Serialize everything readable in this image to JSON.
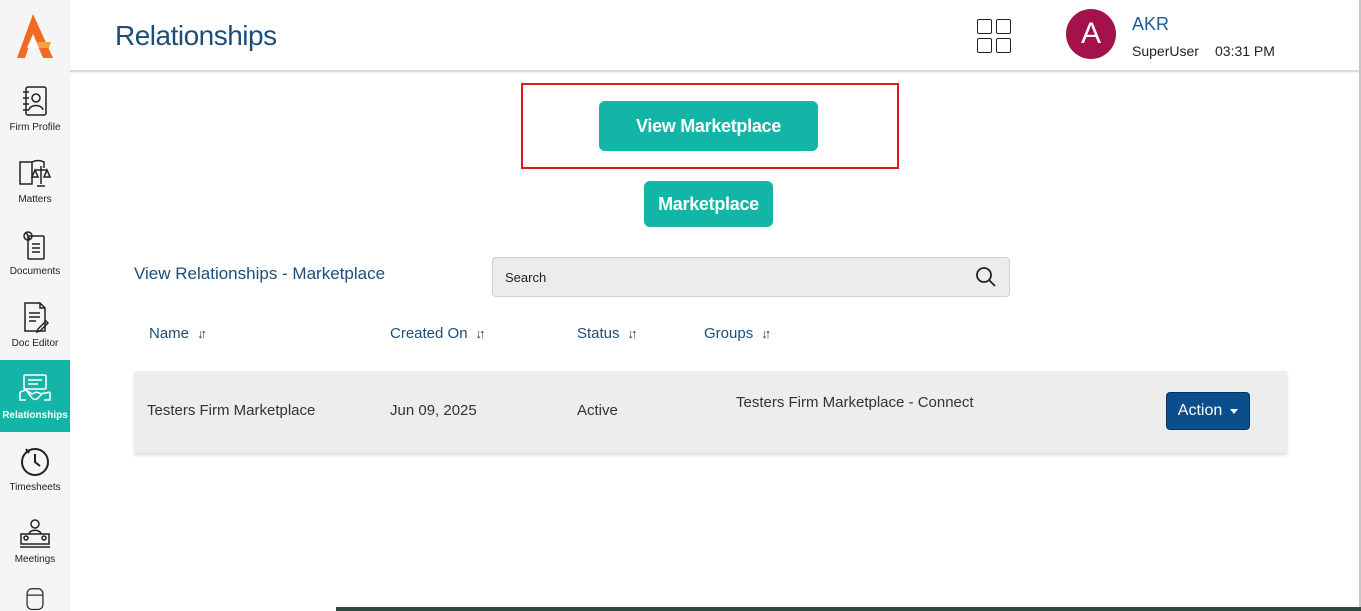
{
  "header": {
    "title": "Relationships",
    "user_initial": "A",
    "user_name": "AKR",
    "user_role": "SuperUser",
    "time": "03:31 PM"
  },
  "sidebar": {
    "items": [
      {
        "label": "Firm Profile",
        "icon": "firm-profile-icon"
      },
      {
        "label": "Matters",
        "icon": "scales-book-icon"
      },
      {
        "label": "Documents",
        "icon": "documents-icon"
      },
      {
        "label": "Doc Editor",
        "icon": "doc-editor-icon"
      },
      {
        "label": "Relationships",
        "icon": "handshake-icon",
        "active": true
      },
      {
        "label": "Timesheets",
        "icon": "timer-icon"
      },
      {
        "label": "Meetings",
        "icon": "meeting-icon"
      }
    ]
  },
  "main": {
    "view_marketplace_label": "View Marketplace",
    "marketplace_label": "Marketplace",
    "section_title": "View Relationships - Marketplace",
    "search_placeholder": "Search",
    "columns": [
      "Name",
      "Created On",
      "Status",
      "Groups"
    ],
    "rows": [
      {
        "name": "Testers Firm Marketplace",
        "created_on": "Jun 09, 2025",
        "status": "Active",
        "groups": "Testers Firm Marketplace - Connect",
        "action": "Action"
      }
    ]
  },
  "colors": {
    "accent_teal": "#12b5a6",
    "title_blue": "#1c4e7a",
    "action_blue": "#0b4e8c",
    "avatar": "#a3124a",
    "highlight_red": "#e01b1b"
  }
}
